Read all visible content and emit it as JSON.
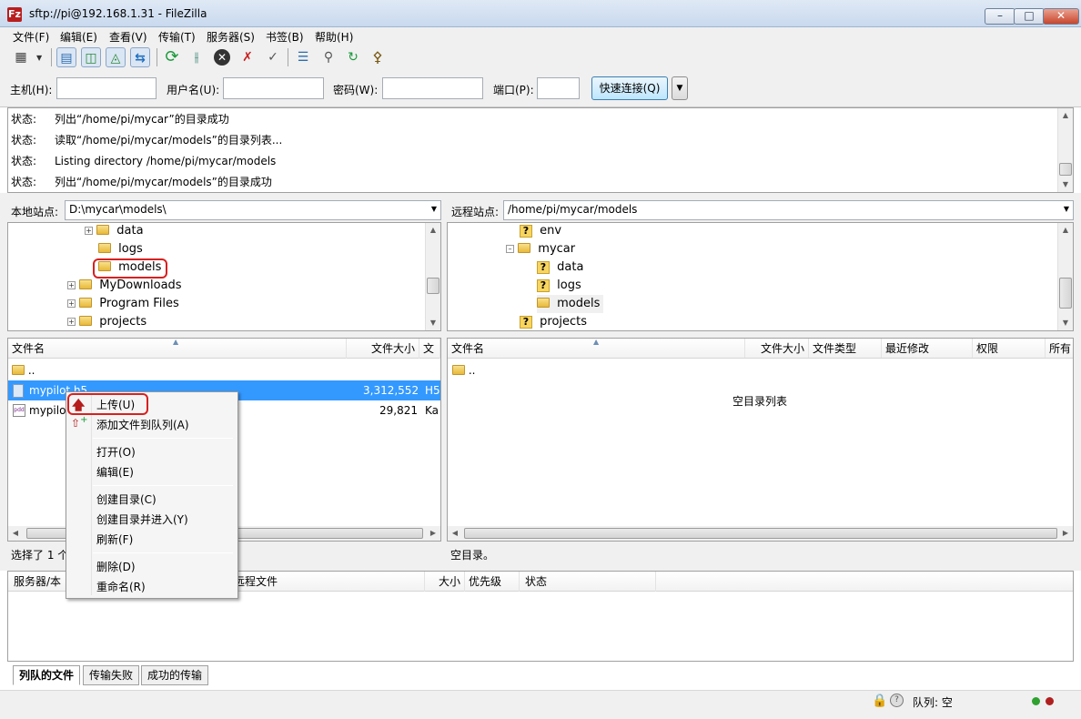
{
  "window": {
    "title": "sftp://pi@192.168.1.31 - FileZilla",
    "app_icon": "Fz"
  },
  "menu": [
    "文件(F)",
    "编辑(E)",
    "查看(V)",
    "传输(T)",
    "服务器(S)",
    "书签(B)",
    "帮助(H)"
  ],
  "toolbar_icons": [
    "site-manager-icon",
    "toggle-log-icon",
    "toggle-local-tree-icon",
    "toggle-remote-tree-icon",
    "toggle-queue-icon",
    "refresh-icon",
    "process-queue-icon",
    "cancel-icon",
    "disconnect-icon",
    "reconnect-icon",
    "directory-listing-filters-icon",
    "compare-icon",
    "sync-browse-icon",
    "search-icon"
  ],
  "quickconnect": {
    "host_label": "主机(H):",
    "user_label": "用户名(U):",
    "pass_label": "密码(W):",
    "port_label": "端口(P):",
    "host_value": "",
    "user_value": "",
    "pass_value": "",
    "port_value": "",
    "connect_label": "快速连接(Q)"
  },
  "log": [
    {
      "key": "状态:",
      "msg": "列出“/home/pi/mycar”的目录成功"
    },
    {
      "key": "状态:",
      "msg": "读取“/home/pi/mycar/models”的目录列表..."
    },
    {
      "key": "状态:",
      "msg": "Listing directory /home/pi/mycar/models"
    },
    {
      "key": "状态:",
      "msg": "列出“/home/pi/mycar/models”的目录成功"
    }
  ],
  "local": {
    "site_label": "本地站点:",
    "path": "D:\\mycar\\models\\",
    "tree": [
      "data",
      "logs",
      "models",
      "MyDownloads",
      "Program Files",
      "projects"
    ],
    "columns": [
      "文件名",
      "文件大小",
      "文"
    ],
    "files": [
      {
        "name": "..",
        "size": "",
        "type": ""
      },
      {
        "name": "mypilot.h5",
        "size": "3,312,552",
        "type": "H5"
      },
      {
        "name": "mypilo",
        "size": "29,821",
        "type": "Ka"
      }
    ],
    "status": "选择了 1 个"
  },
  "remote": {
    "site_label": "远程站点:",
    "path": "/home/pi/mycar/models",
    "tree": [
      "env",
      "mycar",
      "data",
      "logs",
      "models",
      "projects"
    ],
    "columns": [
      "文件名",
      "文件大小",
      "文件类型",
      "最近修改",
      "权限",
      "所有"
    ],
    "files": [
      {
        "name": ".."
      }
    ],
    "empty_text": "空目录列表",
    "status": "空目录。"
  },
  "context_menu": {
    "items": [
      "上传(U)",
      "添加文件到队列(A)",
      "打开(O)",
      "编辑(E)",
      "创建目录(C)",
      "创建目录并进入(Y)",
      "刷新(F)",
      "删除(D)",
      "重命名(R)"
    ]
  },
  "queue": {
    "columns": [
      "服务器/本",
      "远程文件",
      "大小",
      "优先级",
      "状态"
    ],
    "tabs": [
      "列队的文件",
      "传输失败",
      "成功的传输"
    ]
  },
  "statusbar": {
    "queue_text": "队列: 空"
  },
  "colors": {
    "selection": "#3399ff",
    "highlight_ring": "#d82020",
    "accent": "#3c7fb1"
  }
}
